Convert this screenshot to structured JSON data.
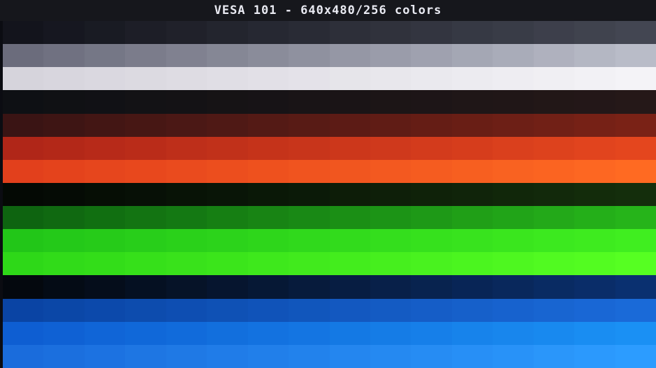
{
  "screen": {
    "title": "VESA 101 - 640x480/256 colors"
  },
  "palette": {
    "cells_per_band": 16,
    "bands": [
      {
        "name": "gray-dark",
        "from": "#13141c",
        "to": "#434652"
      },
      {
        "name": "gray-mid",
        "from": "#6b6c7c",
        "to": "#b9bcc8"
      },
      {
        "name": "gray-light",
        "from": "#d6d4dc",
        "to": "#f4f3f7"
      },
      {
        "name": "red-dark",
        "from": "#0e1014",
        "to": "#251818"
      },
      {
        "name": "red-mid-dark",
        "from": "#3a1414",
        "to": "#7a2216"
      },
      {
        "name": "red-mid",
        "from": "#b02618",
        "to": "#e4461e"
      },
      {
        "name": "red-bright",
        "from": "#e2401c",
        "to": "#ff6a22"
      },
      {
        "name": "green-dark",
        "from": "#040904",
        "to": "#142e0c"
      },
      {
        "name": "green-mid",
        "from": "#0e6410",
        "to": "#26b41a"
      },
      {
        "name": "green-bright",
        "from": "#22c618",
        "to": "#40ee20"
      },
      {
        "name": "green-light",
        "from": "#2ed818",
        "to": "#56ff22"
      },
      {
        "name": "blue-dark",
        "from": "#04080e",
        "to": "#0a3070"
      },
      {
        "name": "blue-mid",
        "from": "#0a44a4",
        "to": "#1a6ad8"
      },
      {
        "name": "blue-bright",
        "from": "#0e5ed2",
        "to": "#1a90f4"
      },
      {
        "name": "blue-light",
        "from": "#1a6cdc",
        "to": "#2c9cff"
      }
    ]
  }
}
